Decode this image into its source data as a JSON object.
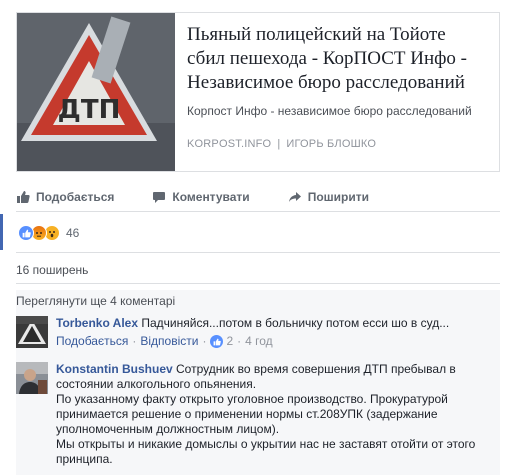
{
  "preview": {
    "title": "Пьяный полицейский на Тойоте сбил пешехода - КорПОСТ Инфо - Независимое бюро расследований",
    "description": "Корпост Инфо - независимое бюро расследований",
    "domain": "KORPOST.INFO",
    "separator": "|",
    "author": "ИГОРЬ БЛОШКО",
    "sign_text": "ДТП"
  },
  "actions": {
    "like": "Подобається",
    "comment": "Коментувати",
    "share": "Поширити"
  },
  "reactions": {
    "icons": [
      "like-icon",
      "angry-icon",
      "wow-icon"
    ],
    "count": "46"
  },
  "shares": "16 поширень",
  "more_comments": "Переглянути ще 4 коментарі",
  "comments": [
    {
      "author": "Torbenko Alex",
      "text": "Падчиняйся...потом в больничку потом есси шо в суд...",
      "like": "Подобається",
      "reply": "Відповісти",
      "likes": "2",
      "time": "4 год"
    },
    {
      "author": "Konstantin Bushuev",
      "text": "Сотрудник во время совершения ДТП пребывал в состоянии алкогольного опьянения.",
      "text2": "По указанному факту открыто уголовное производство. Прокуратурой принимается решение о применении нормы ст.208УПК (задержание уполномоченным должностным лицом).",
      "text3": "Мы открыты и никакие домыслы о укрытии нас не заставят отойти от этого принципа."
    }
  ],
  "colors": {
    "link": "#365899",
    "accent": "#4267b2",
    "like": "#5890ff"
  }
}
